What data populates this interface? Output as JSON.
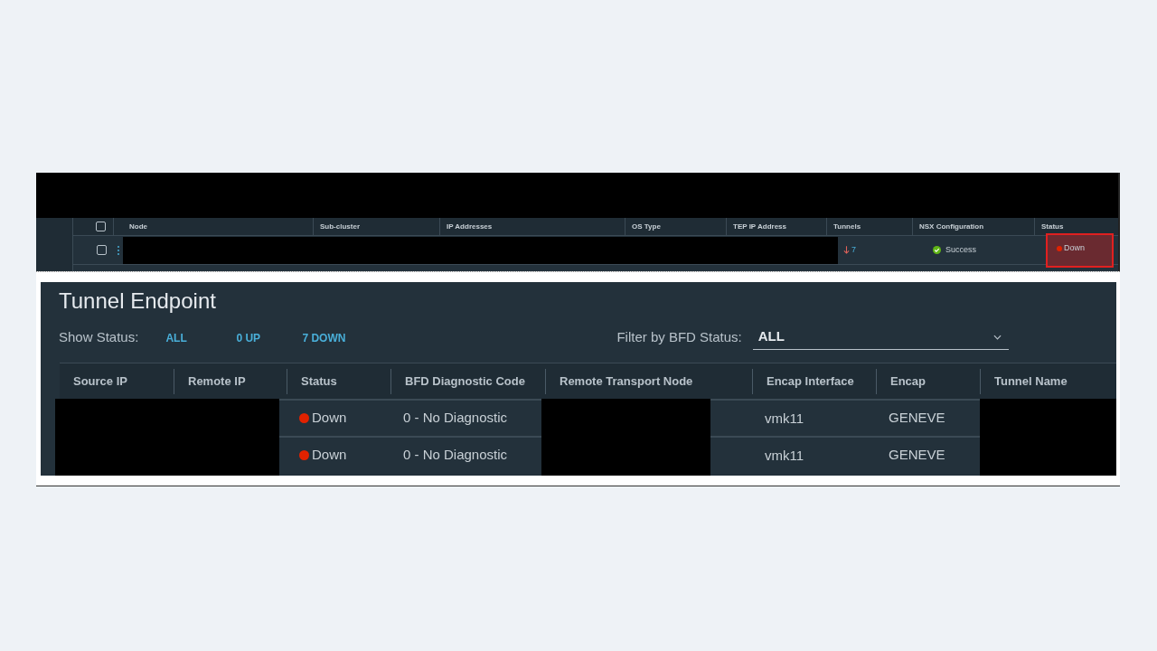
{
  "node_table": {
    "header_checked": false,
    "columns": [
      "Node",
      "Sub-cluster",
      "IP Addresses",
      "OS Type",
      "TEP IP Address",
      "Tunnels",
      "NSX Configuration",
      "Status"
    ],
    "rows": [
      {
        "checked": false,
        "tunnels": {
          "value": "7",
          "kind": "down"
        },
        "nsx_configuration": {
          "value": "Success",
          "kind": "success"
        },
        "status": {
          "value": "Down",
          "kind": "down"
        },
        "highlighted": true
      }
    ]
  },
  "tunnel_endpoint": {
    "title": "Tunnel Endpoint",
    "show_status": {
      "label": "Show Status:",
      "options": [
        "ALL",
        "0 UP",
        "7 DOWN"
      ]
    },
    "filter": {
      "label": "Filter by BFD Status:",
      "value": "ALL"
    },
    "columns": [
      "Source IP",
      "Remote IP",
      "Status",
      "BFD Diagnostic Code",
      "Remote Transport Node",
      "Encap Interface",
      "Encap",
      "Tunnel Name"
    ],
    "rows": [
      {
        "status": "Down",
        "kind": "down",
        "bfd_diagnostic_code": "0 - No Diagnostic",
        "encap_interface": "vmk11",
        "encap": "GENEVE"
      },
      {
        "status": "Down",
        "kind": "down",
        "bfd_diagnostic_code": "0 - No Diagnostic",
        "encap_interface": "vmk11",
        "encap": "GENEVE"
      }
    ]
  }
}
